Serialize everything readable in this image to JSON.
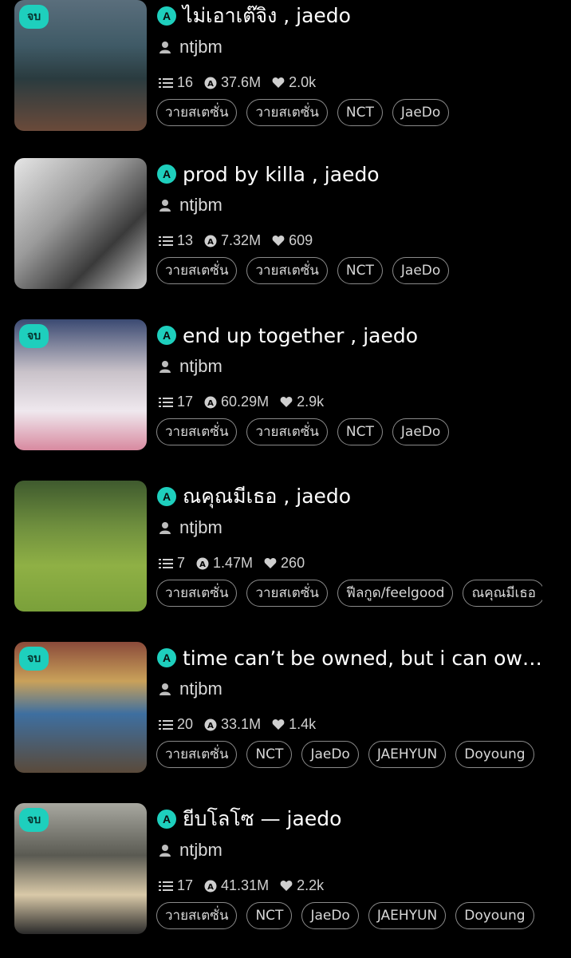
{
  "stories": [
    {
      "ended": true,
      "end_label": "จบ",
      "title": "ไม่เอาเต๊จิง , jaedo",
      "author": "ntjbm",
      "chapters": "16",
      "reads": "37.6M",
      "likes": "2.0k",
      "tags": [
        "วายสเตซั่น",
        "วายสเตซั่น",
        "NCT",
        "JaeDo"
      ]
    },
    {
      "ended": false,
      "end_label": "",
      "title": "prod by killa , jaedo",
      "author": "ntjbm",
      "chapters": "13",
      "reads": "7.32M",
      "likes": "609",
      "tags": [
        "วายสเตซั่น",
        "วายสเตซั่น",
        "NCT",
        "JaeDo"
      ]
    },
    {
      "ended": true,
      "end_label": "จบ",
      "title": "end up together , jaedo",
      "author": "ntjbm",
      "chapters": "17",
      "reads": "60.29M",
      "likes": "2.9k",
      "tags": [
        "วายสเตซั่น",
        "วายสเตซั่น",
        "NCT",
        "JaeDo"
      ]
    },
    {
      "ended": false,
      "end_label": "",
      "title": "ณคุณมีเธอ , jaedo",
      "author": "ntjbm",
      "chapters": "7",
      "reads": "1.47M",
      "likes": "260",
      "tags": [
        "วายสเตซั่น",
        "วายสเตซั่น",
        "ฟีลกูด/feelgood",
        "ณคุณมีเธอ"
      ]
    },
    {
      "ended": true,
      "end_label": "จบ",
      "title": "time can’t be owned, but i can ow…",
      "author": "ntjbm",
      "chapters": "20",
      "reads": "33.1M",
      "likes": "1.4k",
      "tags": [
        "วายสเตซั่น",
        "NCT",
        "JaeDo",
        "JAEHYUN",
        "Doyoung"
      ]
    },
    {
      "ended": true,
      "end_label": "จบ",
      "title": "ยีบโลโซ — jaedo",
      "author": "ntjbm",
      "chapters": "17",
      "reads": "41.31M",
      "likes": "2.2k",
      "tags": [
        "วายสเตซั่น",
        "NCT",
        "JaeDo",
        "JAEHYUN",
        "Doyoung"
      ]
    }
  ],
  "colors": {
    "accent": "#1ecfbd",
    "background": "#000000"
  },
  "icons": {
    "app": "app-logo-icon",
    "author": "user-icon",
    "chapters": "list-icon",
    "reads": "reads-icon",
    "likes": "heart-icon"
  }
}
